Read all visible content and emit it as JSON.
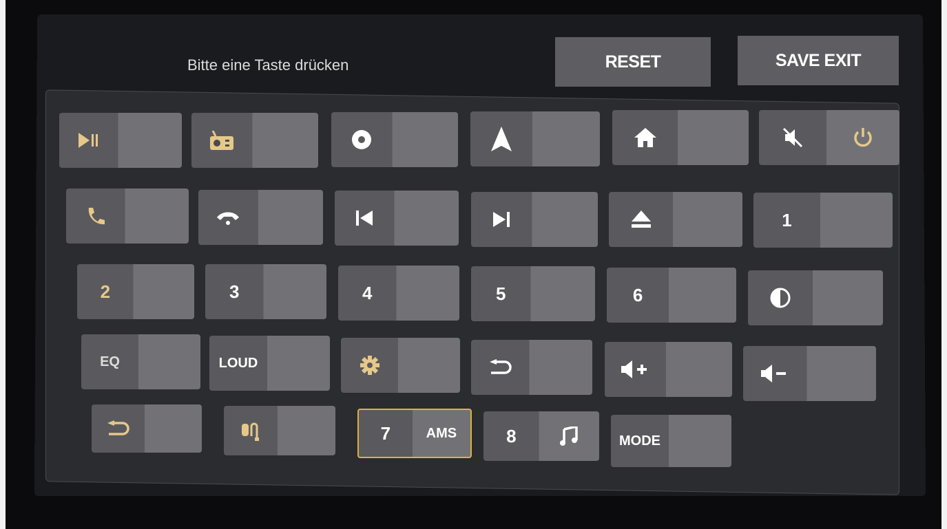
{
  "header": {
    "prompt": "Bitte eine Taste drücken",
    "reset_label": "RESET",
    "save_exit_label": "SAVE EXIT"
  },
  "colors": {
    "icon_gold": "#e6c88a",
    "selected_border": "#e0b040",
    "text_white": "#ffffff"
  },
  "keys": {
    "play_pause": {
      "icon": "play-pause-icon"
    },
    "radio": {
      "icon": "radio-icon"
    },
    "disc": {
      "icon": "disc-icon"
    },
    "navigation": {
      "icon": "navigation-icon"
    },
    "home": {
      "icon": "home-icon"
    },
    "mute_power": {
      "icon_left": "mute-icon",
      "icon_right": "power-icon"
    },
    "call": {
      "icon": "phone-icon"
    },
    "hangup": {
      "icon": "hang-up-icon"
    },
    "prev": {
      "icon": "previous-track-icon"
    },
    "next": {
      "icon": "next-track-icon"
    },
    "eject": {
      "icon": "eject-icon"
    },
    "k1": {
      "label": "1"
    },
    "k2": {
      "label": "2"
    },
    "k3": {
      "label": "3"
    },
    "k4": {
      "label": "4"
    },
    "k5": {
      "label": "5"
    },
    "k6": {
      "label": "6"
    },
    "contrast": {
      "icon": "contrast-icon"
    },
    "eq": {
      "label": "EQ"
    },
    "loud": {
      "label": "LOUD"
    },
    "settings": {
      "icon": "gear-icon"
    },
    "back": {
      "icon": "back-icon"
    },
    "vol_up": {
      "icon": "volume-up-icon"
    },
    "vol_down": {
      "icon": "volume-down-icon"
    },
    "back_gold": {
      "icon": "back-icon"
    },
    "aux": {
      "icon": "aux-input-icon"
    },
    "k7": {
      "label": "7",
      "label_right": "AMS"
    },
    "k8": {
      "label": "8",
      "icon_right": "music-note-icon"
    },
    "mode": {
      "label": "MODE"
    }
  }
}
